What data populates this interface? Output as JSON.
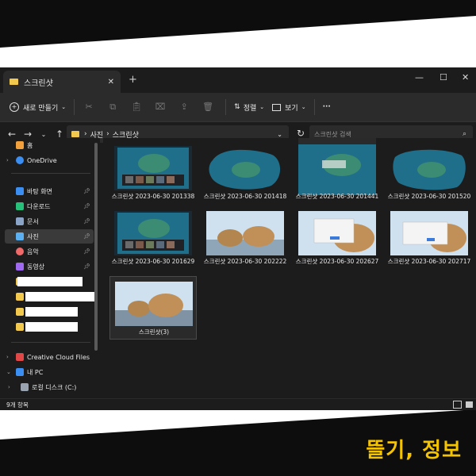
{
  "window": {
    "tab_title": "스크린샷",
    "new_tab": "+",
    "close": "✕"
  },
  "controls": {
    "minimize": "—",
    "maximize": "☐",
    "close": "✕"
  },
  "toolbar": {
    "new_label": "새로 만들기",
    "sort_label": "정렬",
    "view_label": "보기",
    "more_label": "···"
  },
  "addressbar": {
    "breadcrumb": [
      "사진",
      "스크린샷"
    ],
    "search_placeholder": "스크린샷 검색"
  },
  "sidebar": {
    "items": [
      {
        "label": "홈",
        "icon": "home-icon",
        "color": "#f2a03b"
      },
      {
        "label": "OneDrive",
        "icon": "cloud-icon",
        "color": "#3b8ef2"
      },
      {
        "label": "바탕 화면",
        "icon": "desktop-icon",
        "color": "#3b8ef2",
        "pinned": true
      },
      {
        "label": "다운로드",
        "icon": "download-icon",
        "color": "#27c07a",
        "pinned": true
      },
      {
        "label": "문서",
        "icon": "document-icon",
        "color": "#8aa4c8",
        "pinned": true
      },
      {
        "label": "사진",
        "icon": "pictures-icon",
        "color": "#5ab0f0",
        "pinned": true,
        "selected": true
      },
      {
        "label": "음악",
        "icon": "music-icon",
        "color": "#f06a6a",
        "pinned": true
      },
      {
        "label": "동영상",
        "icon": "video-icon",
        "color": "#a06af0",
        "pinned": true
      },
      {
        "label": "Creative Cloud Files",
        "icon": "creative-cloud-icon",
        "color": "#e04848"
      },
      {
        "label": "내 PC",
        "icon": "pc-icon",
        "color": "#3b8ef2"
      },
      {
        "label": "로컬 디스크 (C:)",
        "icon": "drive-icon",
        "color": "#9aa4b0"
      }
    ]
  },
  "files": [
    {
      "name": "스크린샷 2023-06-30 201338",
      "thumb": "turtle-wide"
    },
    {
      "name": "스크린샷 2023-06-30 201418",
      "thumb": "turtle-blob"
    },
    {
      "name": "스크린샷 2023-06-30 201441",
      "thumb": "turtle-tall"
    },
    {
      "name": "스크린샷 2023-06-30 201520",
      "thumb": "turtle-blob"
    },
    {
      "name": "스크린샷 2023-06-30 201629",
      "thumb": "turtle-wide"
    },
    {
      "name": "스크린샷 2023-06-30 202222",
      "thumb": "bears"
    },
    {
      "name": "스크린샷 2023-06-30 202627",
      "thumb": "bears-dialog"
    },
    {
      "name": "스크린샷 2023-06-30 202717",
      "thumb": "bears-dialog"
    },
    {
      "name": "스크린샷(3)",
      "thumb": "bears-selected"
    }
  ],
  "status": {
    "count": "9개 항목"
  },
  "brand": {
    "text": "뜰기, 정보"
  }
}
